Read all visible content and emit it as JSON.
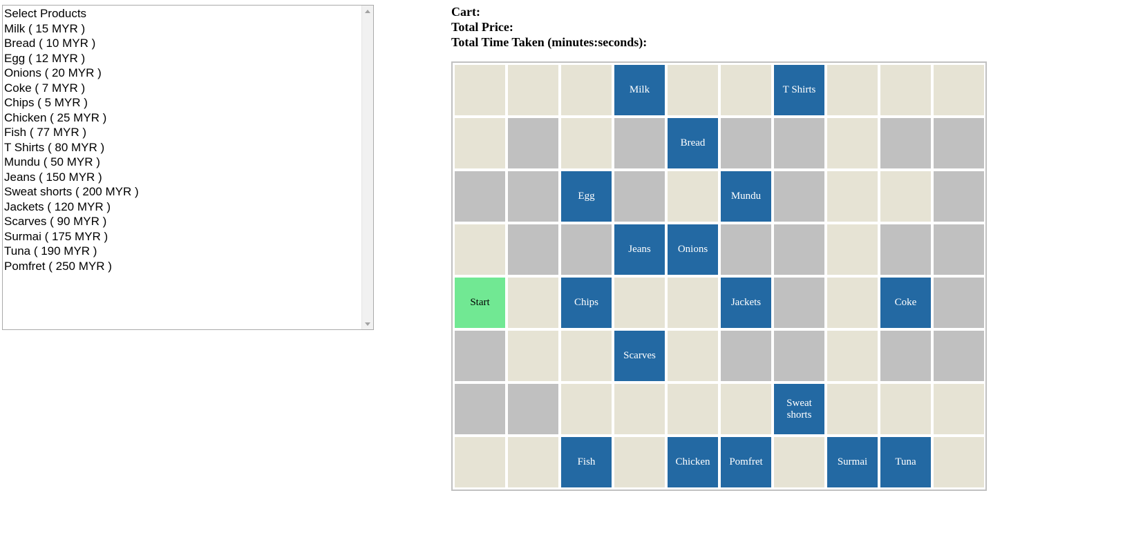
{
  "products": {
    "header": "Select Products",
    "options": [
      "Milk ( 15 MYR )",
      "Bread ( 10 MYR )",
      "Egg ( 12 MYR )",
      "Onions ( 20 MYR )",
      "Coke ( 7 MYR )",
      "Chips ( 5 MYR )",
      "Chicken ( 25 MYR )",
      "Fish ( 77 MYR )",
      "T Shirts ( 80 MYR )",
      "Mundu ( 50 MYR )",
      "Jeans ( 150 MYR )",
      "Sweat shorts ( 200 MYR )",
      "Jackets ( 120 MYR )",
      "Scarves ( 90 MYR )",
      "Surmai ( 175 MYR )",
      "Tuna ( 190 MYR )",
      "Pomfret ( 250 MYR )"
    ]
  },
  "info": {
    "cart_label": "Cart:",
    "cart_value": "",
    "total_price_label": "Total Price:",
    "total_price_value": "",
    "time_label": "Total Time Taken (minutes:seconds):",
    "time_value": ""
  },
  "colors": {
    "empty": "#e6e3d4",
    "wall": "#c0c0c0",
    "product": "#2369a3",
    "start": "#71e893"
  },
  "grid": {
    "legend": {
      "E": "empty",
      "W": "wall",
      "P": "product",
      "S": "start"
    },
    "rows": [
      [
        {
          "t": "E"
        },
        {
          "t": "E"
        },
        {
          "t": "E"
        },
        {
          "t": "P",
          "label": "Milk"
        },
        {
          "t": "E"
        },
        {
          "t": "E"
        },
        {
          "t": "P",
          "label": "T Shirts"
        },
        {
          "t": "E"
        },
        {
          "t": "E"
        },
        {
          "t": "E"
        }
      ],
      [
        {
          "t": "E"
        },
        {
          "t": "W"
        },
        {
          "t": "E"
        },
        {
          "t": "W"
        },
        {
          "t": "P",
          "label": "Bread"
        },
        {
          "t": "W"
        },
        {
          "t": "W"
        },
        {
          "t": "E"
        },
        {
          "t": "W"
        },
        {
          "t": "W"
        }
      ],
      [
        {
          "t": "W"
        },
        {
          "t": "W"
        },
        {
          "t": "P",
          "label": "Egg"
        },
        {
          "t": "W"
        },
        {
          "t": "E"
        },
        {
          "t": "P",
          "label": "Mundu"
        },
        {
          "t": "W"
        },
        {
          "t": "E"
        },
        {
          "t": "E"
        },
        {
          "t": "W"
        }
      ],
      [
        {
          "t": "E"
        },
        {
          "t": "W"
        },
        {
          "t": "W"
        },
        {
          "t": "P",
          "label": "Jeans"
        },
        {
          "t": "P",
          "label": "Onions"
        },
        {
          "t": "W"
        },
        {
          "t": "W"
        },
        {
          "t": "E"
        },
        {
          "t": "W"
        },
        {
          "t": "W"
        }
      ],
      [
        {
          "t": "S",
          "label": "Start"
        },
        {
          "t": "E"
        },
        {
          "t": "P",
          "label": "Chips"
        },
        {
          "t": "E"
        },
        {
          "t": "E"
        },
        {
          "t": "P",
          "label": "Jackets"
        },
        {
          "t": "W"
        },
        {
          "t": "E"
        },
        {
          "t": "P",
          "label": "Coke"
        },
        {
          "t": "W"
        }
      ],
      [
        {
          "t": "W"
        },
        {
          "t": "E"
        },
        {
          "t": "E"
        },
        {
          "t": "P",
          "label": "Scarves"
        },
        {
          "t": "E"
        },
        {
          "t": "W"
        },
        {
          "t": "W"
        },
        {
          "t": "E"
        },
        {
          "t": "W"
        },
        {
          "t": "W"
        }
      ],
      [
        {
          "t": "W"
        },
        {
          "t": "W"
        },
        {
          "t": "E"
        },
        {
          "t": "E"
        },
        {
          "t": "E"
        },
        {
          "t": "E"
        },
        {
          "t": "P",
          "label": "Sweat shorts"
        },
        {
          "t": "E"
        },
        {
          "t": "E"
        },
        {
          "t": "E"
        }
      ],
      [
        {
          "t": "E"
        },
        {
          "t": "E"
        },
        {
          "t": "P",
          "label": "Fish"
        },
        {
          "t": "E"
        },
        {
          "t": "P",
          "label": "Chicken"
        },
        {
          "t": "P",
          "label": "Pomfret"
        },
        {
          "t": "E"
        },
        {
          "t": "P",
          "label": "Surmai"
        },
        {
          "t": "P",
          "label": "Tuna"
        },
        {
          "t": "E"
        }
      ]
    ]
  }
}
